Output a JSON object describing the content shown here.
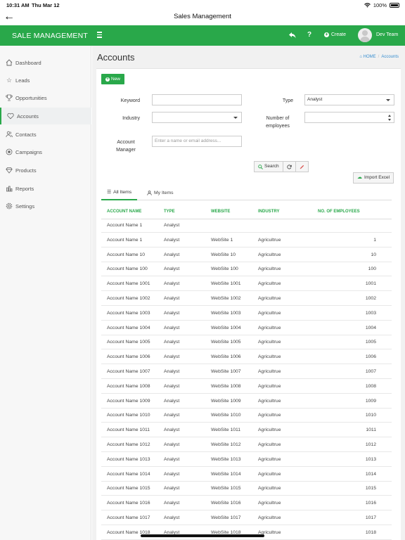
{
  "status": {
    "time": "10:31 AM",
    "date": "Thu Mar 12",
    "battery": "100%"
  },
  "nav": {
    "title": "Sales Management",
    "back_icon": "arrow-left-icon"
  },
  "header": {
    "brand": "SALE MANAGEMENT",
    "help": "?",
    "create_label": "Create",
    "user_name": "Dev Team",
    "accent_color": "#29a84a"
  },
  "sidebar": {
    "items": [
      {
        "label": "Dashboard",
        "icon": "home-icon"
      },
      {
        "label": "Leads",
        "icon": "star-icon"
      },
      {
        "label": "Opportunities",
        "icon": "trophy-icon"
      },
      {
        "label": "Accounts",
        "icon": "heart-icon",
        "active": true
      },
      {
        "label": "Contacts",
        "icon": "users-icon"
      },
      {
        "label": "Campaigns",
        "icon": "target-icon"
      },
      {
        "label": "Products",
        "icon": "diamond-icon"
      },
      {
        "label": "Reports",
        "icon": "bar-chart-icon"
      },
      {
        "label": "Settings",
        "icon": "gear-icon"
      }
    ]
  },
  "page": {
    "title": "Accounts",
    "breadcrumb_home": "HOME",
    "breadcrumb_current": "Accounts"
  },
  "actions": {
    "new_label": "New",
    "search_label": "Search",
    "import_label": "Import Excel"
  },
  "filters": {
    "keyword_label": "Keyword",
    "keyword_value": "",
    "type_label": "Type",
    "type_value": "Analyst",
    "industry_label": "Industry",
    "industry_value": "",
    "employees_label": "Number of employees",
    "employees_value": "",
    "manager_label": "Account Manager",
    "manager_placeholder": "Enter a name or email address..."
  },
  "tabs": [
    {
      "label": "All Items",
      "active": true
    },
    {
      "label": "My Items"
    }
  ],
  "table": {
    "columns": [
      "ACCOUNT NAME",
      "TYPE",
      "WEBSITE",
      "INDUSTRY",
      "NO. OF EMPLOYEES"
    ],
    "rows": [
      [
        "Account Name 1",
        "Analyst",
        "",
        "",
        ""
      ],
      [
        "Account Name 1",
        "Analyst",
        "WebSite 1",
        "Agricultrue",
        "1"
      ],
      [
        "Account Name 10",
        "Analyst",
        "WebSite 10",
        "Agricultrue",
        "10"
      ],
      [
        "Account Name 100",
        "Analyst",
        "WebSite 100",
        "Agricultrue",
        "100"
      ],
      [
        "Account Name 1001",
        "Analyst",
        "WebSite 1001",
        "Agricultrue",
        "1001"
      ],
      [
        "Account Name 1002",
        "Analyst",
        "WebSite 1002",
        "Agricultrue",
        "1002"
      ],
      [
        "Account Name 1003",
        "Analyst",
        "WebSite 1003",
        "Agricultrue",
        "1003"
      ],
      [
        "Account Name 1004",
        "Analyst",
        "WebSite 1004",
        "Agricultrue",
        "1004"
      ],
      [
        "Account Name 1005",
        "Analyst",
        "WebSite 1005",
        "Agricultrue",
        "1005"
      ],
      [
        "Account Name 1006",
        "Analyst",
        "WebSite 1006",
        "Agricultrue",
        "1006"
      ],
      [
        "Account Name 1007",
        "Analyst",
        "WebSite 1007",
        "Agricultrue",
        "1007"
      ],
      [
        "Account Name 1008",
        "Analyst",
        "WebSite 1008",
        "Agricultrue",
        "1008"
      ],
      [
        "Account Name 1009",
        "Analyst",
        "WebSite 1009",
        "Agricultrue",
        "1009"
      ],
      [
        "Account Name 1010",
        "Analyst",
        "WebSite 1010",
        "Agricultrue",
        "1010"
      ],
      [
        "Account Name 1011",
        "Analyst",
        "WebSite 1011",
        "Agricultrue",
        "1011"
      ],
      [
        "Account Name 1012",
        "Analyst",
        "WebSite 1012",
        "Agricultrue",
        "1012"
      ],
      [
        "Account Name 1013",
        "Analyst",
        "WebSite 1013",
        "Agricultrue",
        "1013"
      ],
      [
        "Account Name 1014",
        "Analyst",
        "WebSite 1014",
        "Agricultrue",
        "1014"
      ],
      [
        "Account Name 1015",
        "Analyst",
        "WebSite 1015",
        "Agricultrue",
        "1015"
      ],
      [
        "Account Name 1016",
        "Analyst",
        "WebSite 1016",
        "Agricultrue",
        "1016"
      ],
      [
        "Account Name 1017",
        "Analyst",
        "WebSite 1017",
        "Agricultrue",
        "1017"
      ],
      [
        "Account Name 1018",
        "Analyst",
        "WebSite 1018",
        "Agricultrue",
        "1018"
      ]
    ]
  }
}
